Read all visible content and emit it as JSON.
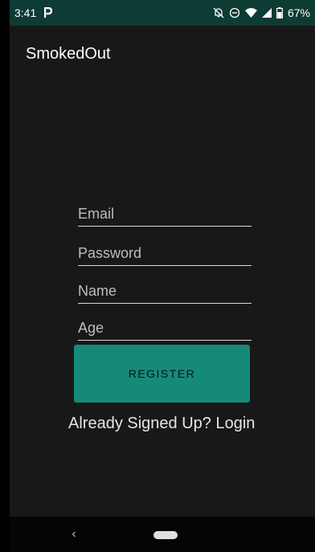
{
  "status_bar": {
    "time": "3:41",
    "app_icon": "parking-p-icon",
    "battery": "67%",
    "icons": [
      "notifications-off-icon",
      "do-not-disturb-icon",
      "wifi-icon",
      "signal-icon",
      "battery-icon"
    ]
  },
  "app_bar": {
    "title": "SmokedOut"
  },
  "form": {
    "email_placeholder": "Email",
    "email_value": "",
    "password_placeholder": "Password",
    "password_value": "",
    "name_placeholder": "Name",
    "name_value": "",
    "age_placeholder": "Age",
    "age_value": "",
    "register_label": "REGISTER",
    "login_link": "Already Signed Up? Login"
  },
  "nav_bar": {
    "back_glyph": "‹"
  },
  "colors": {
    "status_bar_bg": "#0e3b33",
    "background": "#181818",
    "accent": "#168a7a"
  }
}
